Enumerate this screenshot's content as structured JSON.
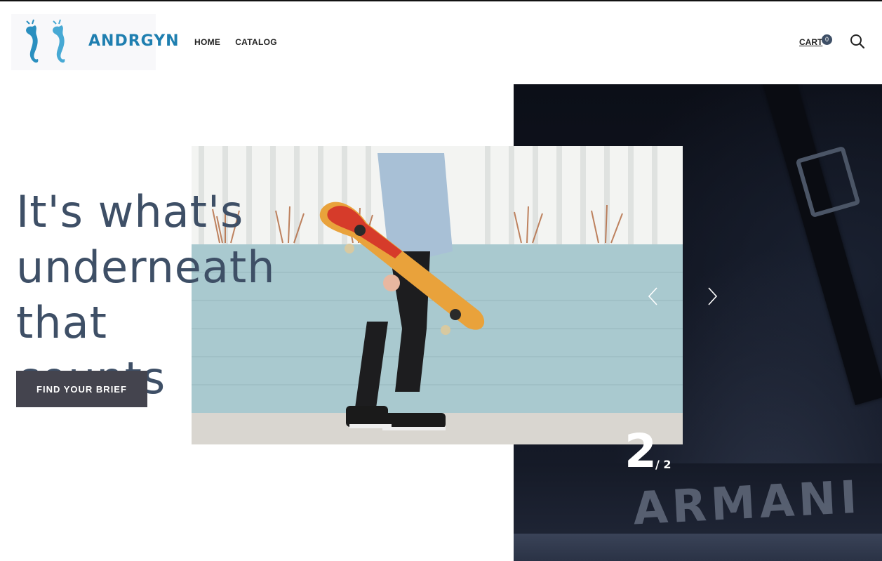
{
  "header": {
    "logo_text": "ANDRGYN",
    "nav": [
      {
        "label": "HOME"
      },
      {
        "label": "CATALOG"
      }
    ],
    "cart_label": "CART",
    "cart_count": "0"
  },
  "hero": {
    "headline_line1": "It's what's",
    "headline_line2": "underneath that",
    "headline_line3": "counts",
    "cta_label": "FIND YOUR BRIEF",
    "slide_current": "2",
    "slide_total": "/ 2",
    "background_brand_text": "ARMANI"
  },
  "colors": {
    "headline": "#3e4f66",
    "cta_bg": "#44444e",
    "badge_bg": "#3e4f66",
    "logo_blue": "#1f7fb0"
  },
  "icons": [
    "seahorse-logo-icon",
    "search-icon",
    "chevron-left-icon",
    "chevron-right-icon"
  ]
}
